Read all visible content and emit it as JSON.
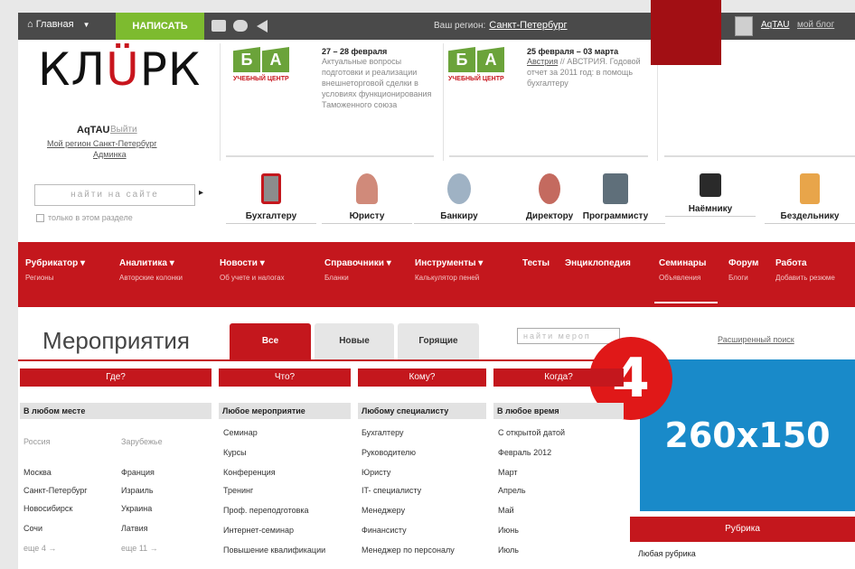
{
  "topbar": {
    "home_label": "Главная",
    "write_label": "НАПИСАТЬ",
    "region_label": "Ваш регион:",
    "region_value": "Санкт-Петербург",
    "user_name": "AqTAU",
    "my_link": "мой блог"
  },
  "logo": {
    "text_a": "КЛ",
    "text_o": "Ü",
    "text_b": "РК"
  },
  "account": {
    "name": "AqTAU",
    "logout": "Выйти",
    "region_link": "Мой регион Санкт-Петербург",
    "admin_link": "Админка"
  },
  "search": {
    "placeholder": "найти на сайте",
    "scope_label": "только в этом разделе"
  },
  "promos": [
    {
      "center": "УЧЕБНЫЙ ЦЕНТР",
      "date": "27 – 28 февраля",
      "text": "Актуальные вопросы подготовки и реализации внешнеторговой сделки в условиях функционирования Таможенного союза"
    },
    {
      "center": "УЧЕБНЫЙ ЦЕНТР",
      "date": "25 февраля – 03 марта",
      "link": "Австрия",
      "text": "// АВСТРИЯ. Годовой отчет за 2011 год: в помощь бухгалтеру"
    }
  ],
  "categories": [
    "Бухгалтеру",
    "Юристу",
    "Банкиру",
    "Директору",
    "Программисту",
    "Наёмнику",
    "Бездельнику"
  ],
  "nav": [
    {
      "label": "Рубрикатор ▾",
      "sub": "Регионы"
    },
    {
      "label": "Аналитика ▾",
      "sub": "Авторские колонки"
    },
    {
      "label": "Новости ▾",
      "sub": "Об учете и налогах"
    },
    {
      "label": "Справочники ▾",
      "sub": "Бланки"
    },
    {
      "label": "Инструменты ▾",
      "sub": "Калькулятор пеней"
    },
    {
      "label": "Тесты",
      "sub": ""
    },
    {
      "label": "Энциклопедия",
      "sub": ""
    },
    {
      "label": "Семинары",
      "sub": "Объявления"
    },
    {
      "label": "Форум",
      "sub": "Блоги"
    },
    {
      "label": "Работа",
      "sub": "Добавить резюме"
    }
  ],
  "events": {
    "title": "Мероприятия",
    "tabs": [
      "Все",
      "Новые",
      "Горящие"
    ],
    "search_placeholder": "найти мероп",
    "advanced_link": "Расширенный поиск"
  },
  "badge": "4",
  "banner": "260x150",
  "columns": [
    {
      "head": "Где?",
      "sub": "В любом месте"
    },
    {
      "head": "Что?",
      "sub": "Любое мероприятие"
    },
    {
      "head": "Кому?",
      "sub": "Любому специалисту"
    },
    {
      "head": "Когда?",
      "sub": "В любое время"
    }
  ],
  "where": {
    "russia": "Россия",
    "abroad": "Зарубежье",
    "left": [
      "Москва",
      "Санкт-Петербург",
      "Новосибирск",
      "Сочи"
    ],
    "right": [
      "Франция",
      "Израиль",
      "Украина",
      "Латвия"
    ],
    "more_left": "еще 4 →",
    "more_right": "еще 11 →"
  },
  "what": [
    "Семинар",
    "Курсы",
    "Конференция",
    "Тренинг",
    "Проф. переподготовка",
    "Интернет-семинар",
    "Повышение квалификации"
  ],
  "whom": [
    "Бухгалтеру",
    "Руководителю",
    "Юристу",
    "IT- специалисту",
    "Менеджеру",
    "Финансисту",
    "Менеджер по персоналу"
  ],
  "when": [
    "С открытой датой",
    "Февраль 2012",
    "Март",
    "Апрель",
    "Май",
    "Июнь",
    "Июль"
  ],
  "rubric": {
    "head": "Рубрика",
    "item": "Любая рубрика"
  },
  "colors": {
    "accent": "#c4171d",
    "green": "#7dbb2f",
    "banner": "#198ac9"
  }
}
